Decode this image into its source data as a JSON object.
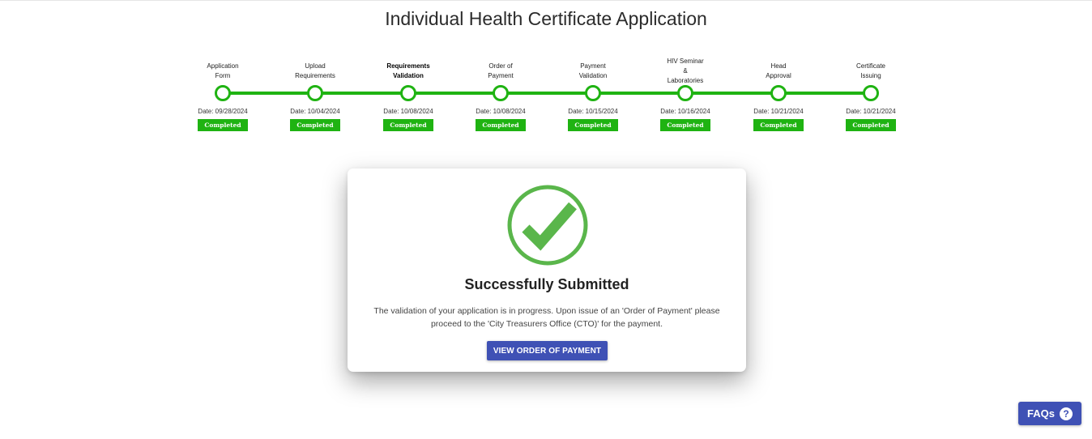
{
  "header": {
    "title": "Individual Health Certificate Application"
  },
  "steps": [
    {
      "label": "Application\nForm",
      "date": "Date: 09/28/2024",
      "status": "Completed",
      "active": false
    },
    {
      "label": "Upload\nRequirements",
      "date": "Date: 10/04/2024",
      "status": "Completed",
      "active": false
    },
    {
      "label": "Requirements\nValidation",
      "date": "Date: 10/08/2024",
      "status": "Completed",
      "active": true
    },
    {
      "label": "Order of\nPayment",
      "date": "Date: 10/08/2024",
      "status": "Completed",
      "active": false
    },
    {
      "label": "Payment\nValidation",
      "date": "Date: 10/15/2024",
      "status": "Completed",
      "active": false
    },
    {
      "label": "HIV Seminar\n&\nLaboratories",
      "date": "Date: 10/16/2024",
      "status": "Completed",
      "active": false
    },
    {
      "label": "Head\nApproval",
      "date": "Date: 10/21/2024",
      "status": "Completed",
      "active": false
    },
    {
      "label": "Certificate\nIssuing",
      "date": "Date: 10/21/2024",
      "status": "Completed",
      "active": false
    }
  ],
  "card": {
    "icon": "check-circle-icon",
    "title": "Successfully Submitted",
    "message": "The validation of your application is in progress. Upon issue of an 'Order of Payment' please proceed to the 'City Treasurers Office (CTO)' for the payment.",
    "button_label": "VIEW ORDER OF PAYMENT"
  },
  "faq": {
    "label": "FAQs",
    "icon": "help-circle-icon"
  },
  "colors": {
    "success_green": "#1fb312",
    "check_green": "#5ab64b",
    "primary_blue": "#3f51b5"
  }
}
